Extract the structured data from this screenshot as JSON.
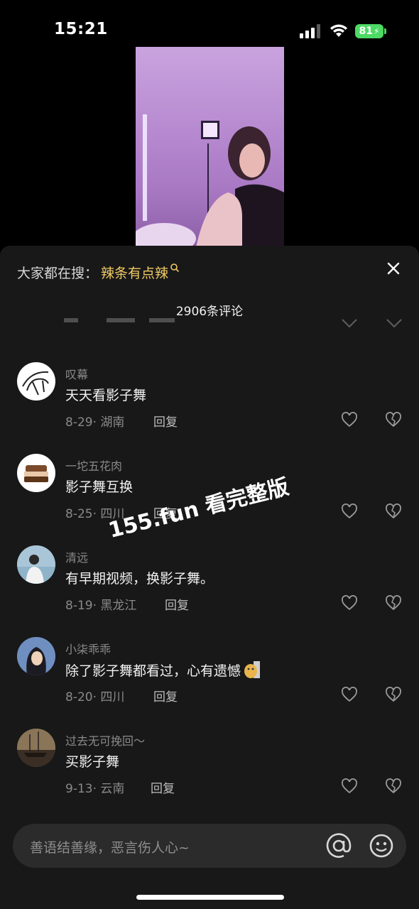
{
  "status_bar": {
    "time": "15:21",
    "battery": "81"
  },
  "search": {
    "prefix": "大家都在搜：",
    "term": "辣条有点辣"
  },
  "comments_header": {
    "count_label": "2906条评论"
  },
  "comments": [
    {
      "user": "叹幕",
      "text": "天天看影子舞",
      "date_location": "8-29· 湖南",
      "reply": "回复"
    },
    {
      "user": "一坨五花肉",
      "text": "影子舞互换",
      "date_location": "8-25· 四川",
      "reply": "回复"
    },
    {
      "user": "清远",
      "text": "有早期视频，换影子舞。",
      "date_location": "8-19· 黑龙江",
      "reply": "回复"
    },
    {
      "user": "小柒乖乖",
      "text": "除了影子舞都看过，心有遗憾",
      "date_location": "8-20· 四川",
      "reply": "回复"
    },
    {
      "user": "过去无可挽回～",
      "text": "买影子舞",
      "date_location": "9-13· 云南",
      "reply": "回复"
    }
  ],
  "watermark": "155.fun 看完整版",
  "input": {
    "placeholder": "善语结善缘，恶言伤人心~"
  },
  "icons": [
    "signal-icon",
    "wifi-icon",
    "battery-icon",
    "search-icon",
    "close-icon",
    "heart-icon",
    "broken-heart-icon",
    "at-icon",
    "emoji-icon"
  ],
  "colors": {
    "sheet_bg": "#181818",
    "accent_search_term": "#f0c964",
    "battery_green": "#4cd964"
  }
}
